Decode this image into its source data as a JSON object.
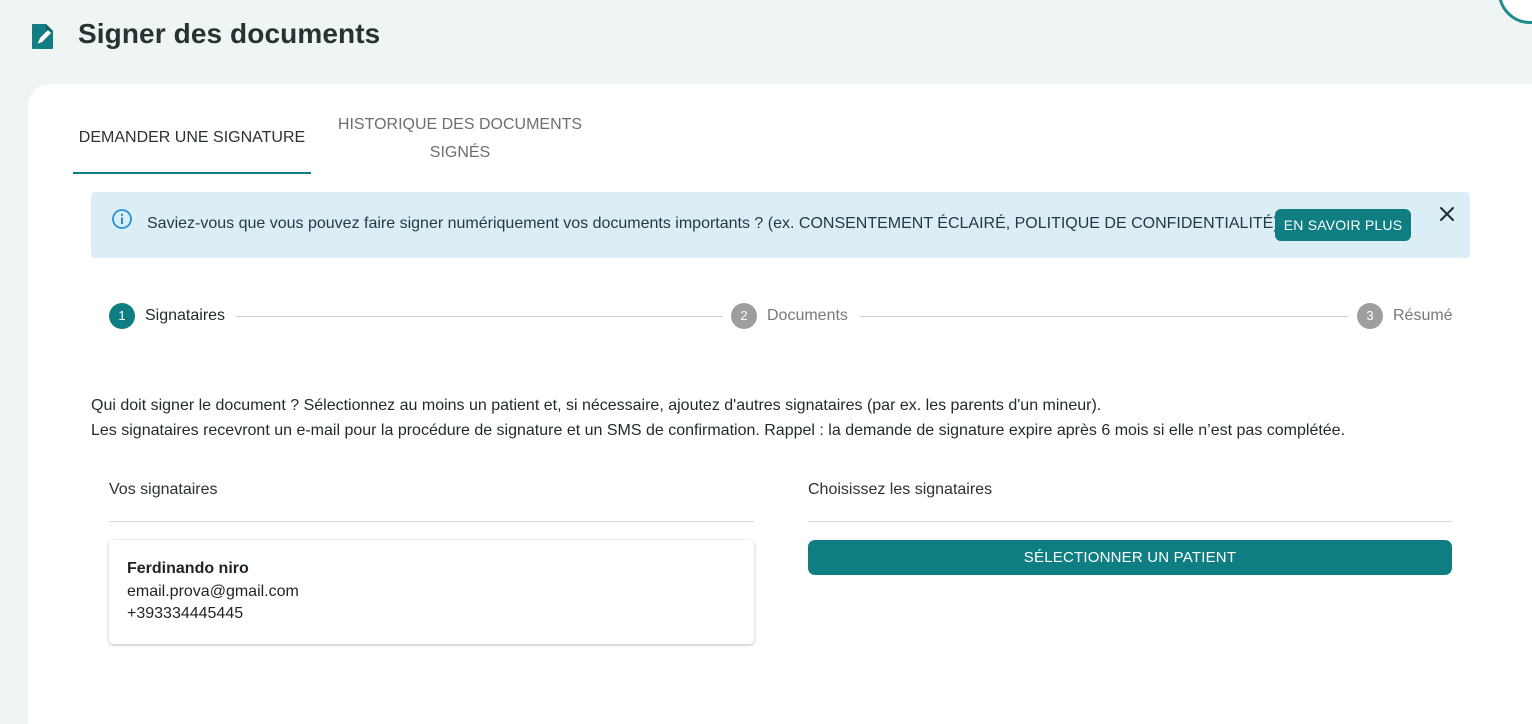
{
  "header": {
    "title": "Signer des documents",
    "icon": "document-sign-icon"
  },
  "tabs": [
    {
      "label": "DEMANDER UNE SIGNATURE",
      "active": true
    },
    {
      "label_line1": "HISTORIQUE DES DOCUMENTS",
      "label_line2": "SIGNÉS",
      "active": false
    }
  ],
  "banner": {
    "icon": "info-icon",
    "text": "Saviez-vous que vous pouvez faire signer numériquement vos documents importants ? (ex. CONSENTEMENT ÉCLAIRÉ, POLITIQUE DE CONFIDENTIALITÉ)",
    "button_label": "EN SAVOIR PLUS",
    "close_icon": "close-icon"
  },
  "stepper": {
    "steps": [
      {
        "number": "1",
        "label": "Signataires",
        "active": true
      },
      {
        "number": "2",
        "label": "Documents",
        "active": false
      },
      {
        "number": "3",
        "label": "Résumé",
        "active": false
      }
    ]
  },
  "description": {
    "line1": "Qui doit signer le document ? Sélectionnez au moins un patient et, si nécessaire, ajoutez d'autres signataires (par ex. les parents d'un mineur).",
    "line2": "Les signataires recevront un e-mail pour la procédure de signature et un SMS de confirmation. Rappel : la demande de signature expire après 6 mois si elle n’est pas complétée."
  },
  "signers_panel": {
    "title": "Vos signataires",
    "signers": [
      {
        "name": "Ferdinando niro",
        "email": "email.prova@gmail.com",
        "phone": "+393334445445"
      }
    ]
  },
  "choose_panel": {
    "title": "Choisissez les signataires",
    "button_label": "SÉLECTIONNER UN PATIENT"
  },
  "colors": {
    "accent": "#0f7e83",
    "banner_bg": "#dbeef6",
    "page_bg": "#eef5f2",
    "step_inactive": "#9e9e9e"
  }
}
